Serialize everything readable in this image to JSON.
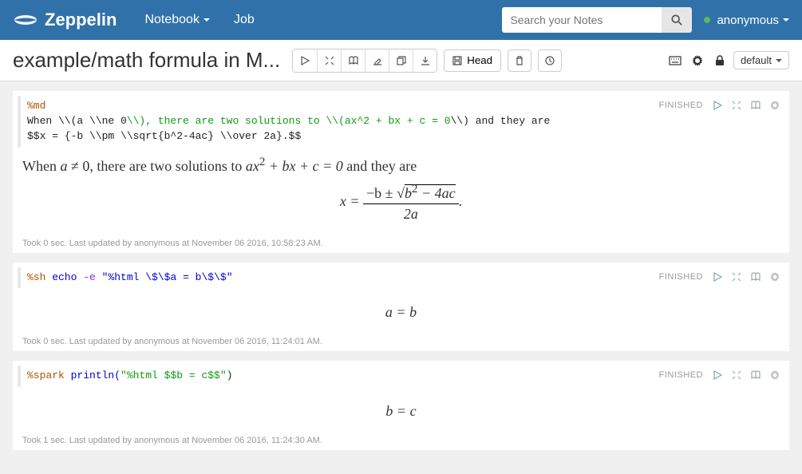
{
  "brand": "Zeppelin",
  "nav": {
    "notebook": "Notebook",
    "job": "Job"
  },
  "search": {
    "placeholder": "Search your Notes"
  },
  "user": {
    "name": "anonymous"
  },
  "note_title": "example/math formula in M...",
  "head_btn": "Head",
  "default_sel": "default",
  "paragraphs": [
    {
      "code": {
        "directive": "%md",
        "line1_a": "When \\\\(a \\\\ne 0",
        "line1_b": "\\\\), there are two solutions to \\\\(ax^2 + bx + c = 0",
        "line1_c": "\\\\) and they are",
        "line2": "$$x = {-b \\\\pm \\\\sqrt{b^2-4ac} \\\\over 2a}.$$"
      },
      "rendered": {
        "pre": "When ",
        "a": "a",
        "ne": " ≠ 0, there are two solutions to ",
        "poly": "ax",
        "sq": "2",
        "rest": " + bx + c = 0",
        "tail": " and they are",
        "x_eq": "x = ",
        "minb": "−b ± ",
        "surd": "√",
        "disc": "b",
        "disc2": "2",
        "disc3": " − 4ac",
        "denom": "2a",
        "dot": "."
      },
      "status": "FINISHED",
      "footer": "Took 0 sec. Last updated by anonymous at November 06 2016, 10:58:23 AM."
    },
    {
      "code": {
        "directive": "%sh",
        "cmd": " echo",
        "opt": " -e",
        "sp": " ",
        "q1": "\"",
        "str": "%html \\$\\$a = b\\$\\$",
        "q2": "\""
      },
      "rendered": {
        "eq": "a = b"
      },
      "status": "FINISHED",
      "footer": "Took 0 sec. Last updated by anonymous at November 06 2016, 11:24:01 AM."
    },
    {
      "code": {
        "directive": "%spark",
        "fn": " println(",
        "q1": "\"",
        "str": "%html $$b = c$$",
        "q2": "\"",
        "close": ")"
      },
      "rendered": {
        "eq": "b = c"
      },
      "status": "FINISHED",
      "footer": "Took 1 sec. Last updated by anonymous at November 06 2016, 11:24:30 AM."
    }
  ]
}
